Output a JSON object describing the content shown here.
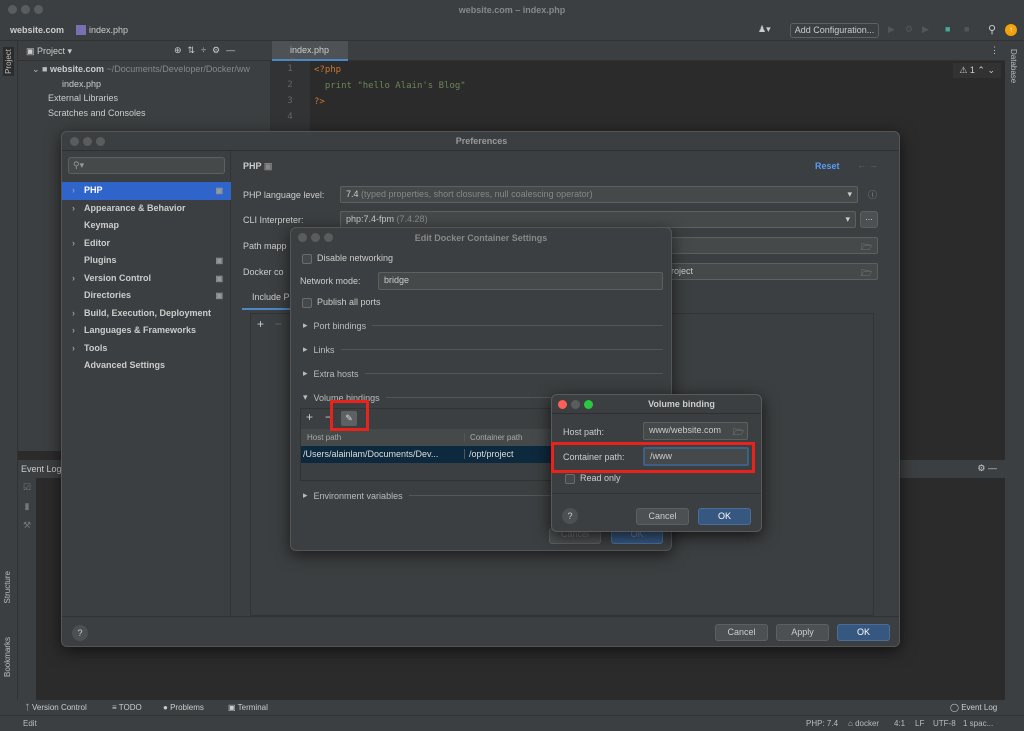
{
  "window": {
    "title": "website.com – index.php"
  },
  "navbar": {
    "breadcrumb": [
      "website.com",
      "index.php"
    ],
    "add_configuration": "Add Configuration..."
  },
  "left_strip": {
    "project": "Project",
    "structure": "Structure",
    "bookmarks": "Bookmarks"
  },
  "right_strip": {
    "database": "Database"
  },
  "project_panel": {
    "title": "Project",
    "root_name": "website.com",
    "root_path": "~/Documents/Developer/Docker/ww",
    "file": "index.php",
    "external": "External Libraries",
    "scratches": "Scratches and Consoles"
  },
  "editor": {
    "tab": "index.php",
    "lines": [
      "<?php",
      "  print \"hello Alain's Blog\"",
      "?>",
      ""
    ],
    "line_numbers": [
      "1",
      "2",
      "3",
      "4"
    ],
    "warnings": "1"
  },
  "event_log": {
    "title": "Event Log"
  },
  "tool_windows": {
    "version_control": "Version Control",
    "todo": "TODO",
    "problems": "Problems",
    "terminal": "Terminal",
    "event_log": "Event Log"
  },
  "status_bar": {
    "left": "Edit",
    "php": "PHP: 7.4",
    "docker": "docker",
    "pos": "4:1",
    "lf": "LF",
    "encoding": "UTF-8",
    "indent": "1 spac..."
  },
  "preferences": {
    "title": "Preferences",
    "nav": [
      {
        "label": "PHP",
        "chev": true,
        "mod": true
      },
      {
        "label": "Appearance & Behavior",
        "chev": true
      },
      {
        "label": "Keymap"
      },
      {
        "label": "Editor",
        "chev": true
      },
      {
        "label": "Plugins",
        "mod": true
      },
      {
        "label": "Version Control",
        "chev": true,
        "mod": true
      },
      {
        "label": "Directories",
        "mod": true
      },
      {
        "label": "Build, Execution, Deployment",
        "chev": true
      },
      {
        "label": "Languages & Frameworks",
        "chev": true
      },
      {
        "label": "Tools",
        "chev": true
      },
      {
        "label": "Advanced Settings"
      }
    ],
    "heading": "PHP",
    "reset": "Reset",
    "lang_level_label": "PHP language level:",
    "lang_level_value": "7.4",
    "lang_level_desc": "(typed properties, short closures, null coalescing operator)",
    "cli_label": "CLI Interpreter:",
    "cli_value": "php:7.4-fpm",
    "cli_version": "(7.4.28)",
    "path_label": "Path mapp",
    "docker_label": "Docker co",
    "docker_value": "roject",
    "include_tab": "Include P",
    "cancel": "Cancel",
    "apply": "Apply",
    "ok": "OK"
  },
  "docker_dialog": {
    "title": "Edit Docker Container Settings",
    "disable_networking": "Disable networking",
    "network_mode_label": "Network mode:",
    "network_mode_value": "bridge",
    "publish_all_ports": "Publish all ports",
    "port_bindings": "Port bindings",
    "links": "Links",
    "extra_hosts": "Extra hosts",
    "volume_bindings": "Volume bindings",
    "columns": [
      "Host path",
      "Container path"
    ],
    "rows": [
      [
        "/Users/alainlam/Documents/Dev...",
        "/opt/project"
      ]
    ],
    "environment_variables": "Environment variables",
    "cancel": "Cancel",
    "ok": "OK"
  },
  "volume_dialog": {
    "title": "Volume binding",
    "host_label": "Host path:",
    "host_value": "www/website.com",
    "container_label": "Container path:",
    "container_value": "/www",
    "read_only": "Read only",
    "cancel": "Cancel",
    "ok": "OK"
  },
  "colors": {
    "accent": "#2f65ca",
    "highlight": "#e8231b",
    "ok_button": "#365880"
  }
}
